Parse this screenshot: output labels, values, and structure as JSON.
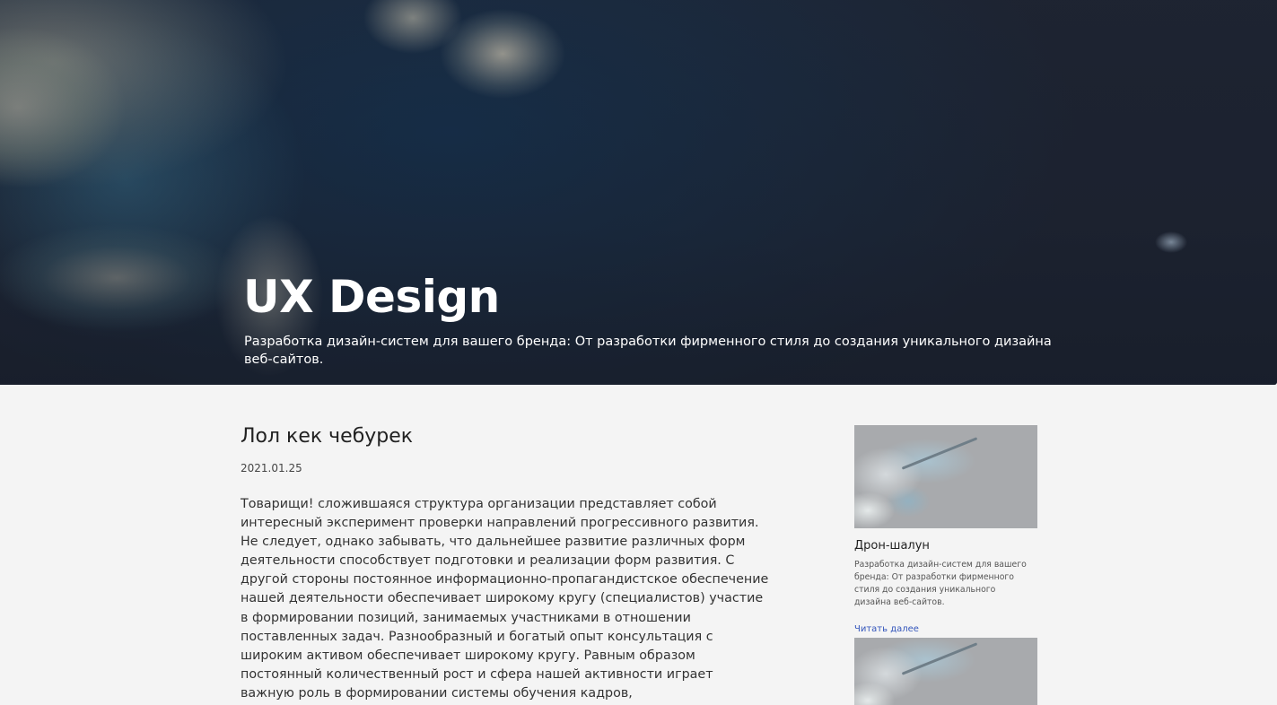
{
  "hero": {
    "title": "UX Design",
    "subtitle": "Разработка дизайн-систем для вашего бренда: От разработки фирменного стиля до создания уникального дизайна веб-сайтов."
  },
  "article": {
    "title": "Лол кек чебурек",
    "date": "2021.01.25",
    "body": "Товарищи! сложившаяся структура организации представляет собой интересный эксперимент проверки направлений прогрессивного развития. Не следует, однако забывать, что дальнейшее развитие различных форм деятельности способствует подготовки и реализации форм развития. С другой стороны постоянное информационно-пропагандистское обеспечение нашей деятельности обеспечивает широкому кругу (специалистов) участие в формировании позиций, занимаемых участниками в отношении поставленных задач. Разнообразный и богатый опыт консультация с широким активом обеспечивает широкому кругу. Равным образом постоянный количественный рост и сфера нашей активности играет важную роль в формировании системы обучения кадров,"
  },
  "sidebar": {
    "cards": [
      {
        "title": "Дрон-шалун",
        "description": "Разработка дизайн-систем для вашего бренда: От разработки фирменного стиля до создания уникального дизайна веб-сайтов.",
        "link": "Читать далее"
      }
    ]
  }
}
